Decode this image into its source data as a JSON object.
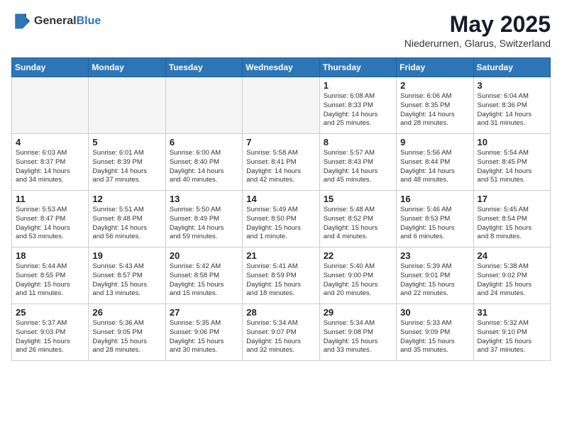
{
  "header": {
    "logo_general": "General",
    "logo_blue": "Blue",
    "title": "May 2025",
    "location": "Niederurnen, Glarus, Switzerland"
  },
  "weekdays": [
    "Sunday",
    "Monday",
    "Tuesday",
    "Wednesday",
    "Thursday",
    "Friday",
    "Saturday"
  ],
  "weeks": [
    [
      {
        "day": "",
        "info": "",
        "empty": true
      },
      {
        "day": "",
        "info": "",
        "empty": true
      },
      {
        "day": "",
        "info": "",
        "empty": true
      },
      {
        "day": "",
        "info": "",
        "empty": true
      },
      {
        "day": "1",
        "info": "Sunrise: 6:08 AM\nSunset: 8:33 PM\nDaylight: 14 hours\nand 25 minutes.",
        "empty": false
      },
      {
        "day": "2",
        "info": "Sunrise: 6:06 AM\nSunset: 8:35 PM\nDaylight: 14 hours\nand 28 minutes.",
        "empty": false
      },
      {
        "day": "3",
        "info": "Sunrise: 6:04 AM\nSunset: 8:36 PM\nDaylight: 14 hours\nand 31 minutes.",
        "empty": false
      }
    ],
    [
      {
        "day": "4",
        "info": "Sunrise: 6:03 AM\nSunset: 8:37 PM\nDaylight: 14 hours\nand 34 minutes.",
        "empty": false
      },
      {
        "day": "5",
        "info": "Sunrise: 6:01 AM\nSunset: 8:39 PM\nDaylight: 14 hours\nand 37 minutes.",
        "empty": false
      },
      {
        "day": "6",
        "info": "Sunrise: 6:00 AM\nSunset: 8:40 PM\nDaylight: 14 hours\nand 40 minutes.",
        "empty": false
      },
      {
        "day": "7",
        "info": "Sunrise: 5:58 AM\nSunset: 8:41 PM\nDaylight: 14 hours\nand 42 minutes.",
        "empty": false
      },
      {
        "day": "8",
        "info": "Sunrise: 5:57 AM\nSunset: 8:43 PM\nDaylight: 14 hours\nand 45 minutes.",
        "empty": false
      },
      {
        "day": "9",
        "info": "Sunrise: 5:56 AM\nSunset: 8:44 PM\nDaylight: 14 hours\nand 48 minutes.",
        "empty": false
      },
      {
        "day": "10",
        "info": "Sunrise: 5:54 AM\nSunset: 8:45 PM\nDaylight: 14 hours\nand 51 minutes.",
        "empty": false
      }
    ],
    [
      {
        "day": "11",
        "info": "Sunrise: 5:53 AM\nSunset: 8:47 PM\nDaylight: 14 hours\nand 53 minutes.",
        "empty": false
      },
      {
        "day": "12",
        "info": "Sunrise: 5:51 AM\nSunset: 8:48 PM\nDaylight: 14 hours\nand 56 minutes.",
        "empty": false
      },
      {
        "day": "13",
        "info": "Sunrise: 5:50 AM\nSunset: 8:49 PM\nDaylight: 14 hours\nand 59 minutes.",
        "empty": false
      },
      {
        "day": "14",
        "info": "Sunrise: 5:49 AM\nSunset: 8:50 PM\nDaylight: 15 hours\nand 1 minute.",
        "empty": false
      },
      {
        "day": "15",
        "info": "Sunrise: 5:48 AM\nSunset: 8:52 PM\nDaylight: 15 hours\nand 4 minutes.",
        "empty": false
      },
      {
        "day": "16",
        "info": "Sunrise: 5:46 AM\nSunset: 8:53 PM\nDaylight: 15 hours\nand 6 minutes.",
        "empty": false
      },
      {
        "day": "17",
        "info": "Sunrise: 5:45 AM\nSunset: 8:54 PM\nDaylight: 15 hours\nand 8 minutes.",
        "empty": false
      }
    ],
    [
      {
        "day": "18",
        "info": "Sunrise: 5:44 AM\nSunset: 8:55 PM\nDaylight: 15 hours\nand 11 minutes.",
        "empty": false
      },
      {
        "day": "19",
        "info": "Sunrise: 5:43 AM\nSunset: 8:57 PM\nDaylight: 15 hours\nand 13 minutes.",
        "empty": false
      },
      {
        "day": "20",
        "info": "Sunrise: 5:42 AM\nSunset: 8:58 PM\nDaylight: 15 hours\nand 15 minutes.",
        "empty": false
      },
      {
        "day": "21",
        "info": "Sunrise: 5:41 AM\nSunset: 8:59 PM\nDaylight: 15 hours\nand 18 minutes.",
        "empty": false
      },
      {
        "day": "22",
        "info": "Sunrise: 5:40 AM\nSunset: 9:00 PM\nDaylight: 15 hours\nand 20 minutes.",
        "empty": false
      },
      {
        "day": "23",
        "info": "Sunrise: 5:39 AM\nSunset: 9:01 PM\nDaylight: 15 hours\nand 22 minutes.",
        "empty": false
      },
      {
        "day": "24",
        "info": "Sunrise: 5:38 AM\nSunset: 9:02 PM\nDaylight: 15 hours\nand 24 minutes.",
        "empty": false
      }
    ],
    [
      {
        "day": "25",
        "info": "Sunrise: 5:37 AM\nSunset: 9:03 PM\nDaylight: 15 hours\nand 26 minutes.",
        "empty": false
      },
      {
        "day": "26",
        "info": "Sunrise: 5:36 AM\nSunset: 9:05 PM\nDaylight: 15 hours\nand 28 minutes.",
        "empty": false
      },
      {
        "day": "27",
        "info": "Sunrise: 5:35 AM\nSunset: 9:06 PM\nDaylight: 15 hours\nand 30 minutes.",
        "empty": false
      },
      {
        "day": "28",
        "info": "Sunrise: 5:34 AM\nSunset: 9:07 PM\nDaylight: 15 hours\nand 32 minutes.",
        "empty": false
      },
      {
        "day": "29",
        "info": "Sunrise: 5:34 AM\nSunset: 9:08 PM\nDaylight: 15 hours\nand 33 minutes.",
        "empty": false
      },
      {
        "day": "30",
        "info": "Sunrise: 5:33 AM\nSunset: 9:09 PM\nDaylight: 15 hours\nand 35 minutes.",
        "empty": false
      },
      {
        "day": "31",
        "info": "Sunrise: 5:32 AM\nSunset: 9:10 PM\nDaylight: 15 hours\nand 37 minutes.",
        "empty": false
      }
    ]
  ]
}
